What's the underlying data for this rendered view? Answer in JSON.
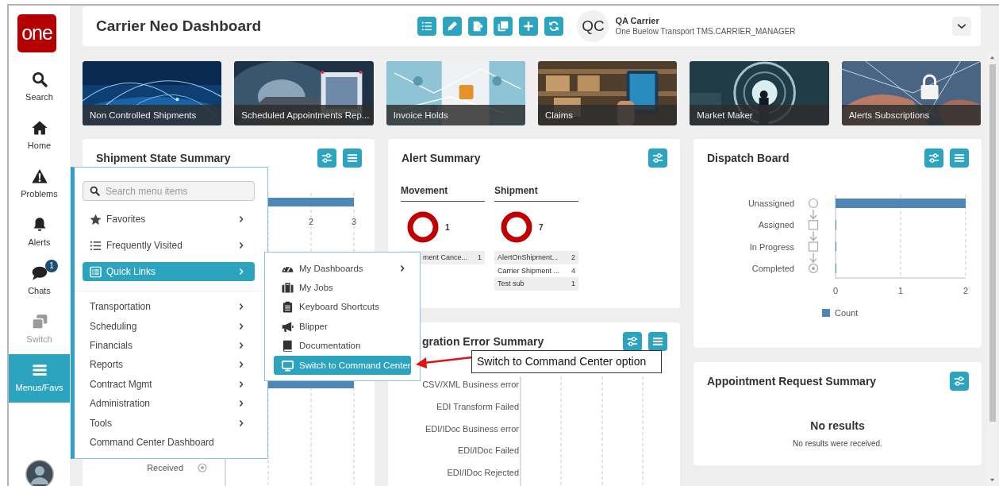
{
  "logo": "one",
  "sidebar": {
    "items": [
      {
        "kind": "search",
        "label": "Search",
        "selected": false,
        "disabled": false
      },
      {
        "kind": "home",
        "label": "Home",
        "selected": false,
        "disabled": false
      },
      {
        "kind": "problems",
        "label": "Problems",
        "selected": false,
        "disabled": false
      },
      {
        "kind": "alerts",
        "label": "Alerts",
        "selected": false,
        "disabled": false
      },
      {
        "kind": "chats",
        "label": "Chats",
        "selected": false,
        "disabled": false,
        "badge": "1"
      },
      {
        "kind": "switch",
        "label": "Switch",
        "selected": false,
        "disabled": true
      },
      {
        "kind": "menus",
        "label": "Menus/Favs",
        "selected": true,
        "disabled": false
      }
    ]
  },
  "header": {
    "title": "Carrier Neo Dashboard",
    "toolbar": [
      {
        "kind": "list"
      },
      {
        "kind": "edit"
      },
      {
        "kind": "export"
      },
      {
        "kind": "copy"
      },
      {
        "kind": "add"
      },
      {
        "kind": "refresh"
      }
    ],
    "user": {
      "initials": "QC",
      "name": "QA Carrier",
      "role": "One Buelow Transport TMS.CARRIER_MANAGER"
    }
  },
  "tiles": [
    {
      "caption": "Non Controlled Shipments"
    },
    {
      "caption": "Scheduled Appointments Rep..."
    },
    {
      "caption": "Invoice Holds"
    },
    {
      "caption": "Claims"
    },
    {
      "caption": "Market Maker"
    },
    {
      "caption": "Alerts Subscriptions"
    }
  ],
  "shipment_state_summary": {
    "title": "Shipment State Summary",
    "buttons": [
      {
        "kind": "settings"
      },
      {
        "kind": "menu"
      }
    ],
    "tick_labels": [
      "2",
      "3"
    ],
    "category_label": "Received"
  },
  "alert_summary": {
    "title": "Alert Summary",
    "buttons": [
      {
        "kind": "settings"
      }
    ],
    "groups": [
      {
        "name": "Movement",
        "count": "1",
        "rows": [
          {
            "label": "ment Cance...",
            "value": "1"
          }
        ]
      },
      {
        "name": "Shipment",
        "count": "7",
        "rows": [
          {
            "label": "AlertOnShipment...",
            "value": "2"
          },
          {
            "label": "Carrier Shipment ...",
            "value": "4"
          },
          {
            "label": "Test sub",
            "value": "1"
          }
        ]
      }
    ]
  },
  "integration_error_summary": {
    "title": "gration Error Summary",
    "buttons": [
      {
        "kind": "settings"
      },
      {
        "kind": "menu"
      }
    ],
    "categories": [
      "CSV/XML Business error",
      "EDI Transform Failed",
      "EDI/IDoc Business error",
      "EDI/IDoc Failed",
      "EDI/IDoc Rejected"
    ]
  },
  "dispatch_board": {
    "title": "Dispatch Board",
    "buttons": [
      {
        "kind": "settings"
      },
      {
        "kind": "menu"
      }
    ],
    "chart_data": {
      "type": "bar",
      "orientation": "horizontal",
      "categories": [
        "Unassigned",
        "Assigned",
        "In Progress",
        "Completed"
      ],
      "series": [
        {
          "name": "Count",
          "color": "#4f86b8",
          "values": [
            2,
            0,
            0,
            0
          ]
        }
      ],
      "xlim": [
        0,
        2
      ],
      "xticks": [
        0,
        1,
        2
      ]
    }
  },
  "appointment_request_summary": {
    "title": "Appointment Request Summary",
    "buttons": [
      {
        "kind": "settings"
      }
    ],
    "empty_title": "No results",
    "empty_message": "No results were received."
  },
  "menu": {
    "search": {
      "placeholder": "Search menu items"
    },
    "pinned": [
      {
        "kind": "favorites",
        "label": "Favorites",
        "selected": false,
        "has_submenu": true
      },
      {
        "kind": "recent",
        "label": "Frequently Visited",
        "selected": false,
        "has_submenu": true
      },
      {
        "kind": "quick_links",
        "label": "Quick Links",
        "selected": true,
        "has_submenu": true
      }
    ],
    "sections": [
      {
        "label": "Transportation",
        "has_submenu": true
      },
      {
        "label": "Scheduling",
        "has_submenu": true
      },
      {
        "label": "Financials",
        "has_submenu": true
      },
      {
        "label": "Reports",
        "has_submenu": true
      },
      {
        "label": "Contract Mgmt",
        "has_submenu": true
      },
      {
        "label": "Administration",
        "has_submenu": true
      },
      {
        "label": "Tools",
        "has_submenu": true
      },
      {
        "label": "Command Center Dashboard",
        "has_submenu": false
      }
    ]
  },
  "submenu": {
    "items": [
      {
        "kind": "dashboards",
        "label": "My Dashboards",
        "has_submenu": true,
        "selected": false
      },
      {
        "kind": "jobs",
        "label": "My Jobs",
        "has_submenu": false,
        "selected": false
      },
      {
        "kind": "shortcuts",
        "label": "Keyboard Shortcuts",
        "has_submenu": false,
        "selected": false
      },
      {
        "kind": "blipper",
        "label": "Blipper",
        "has_submenu": false,
        "selected": false
      },
      {
        "kind": "documentation",
        "label": "Documentation",
        "has_submenu": false,
        "selected": false
      },
      {
        "kind": "command_center",
        "label": "Switch to Command Center",
        "has_submenu": false,
        "selected": true
      }
    ]
  },
  "callout": {
    "text": "Switch to Command Center option"
  }
}
